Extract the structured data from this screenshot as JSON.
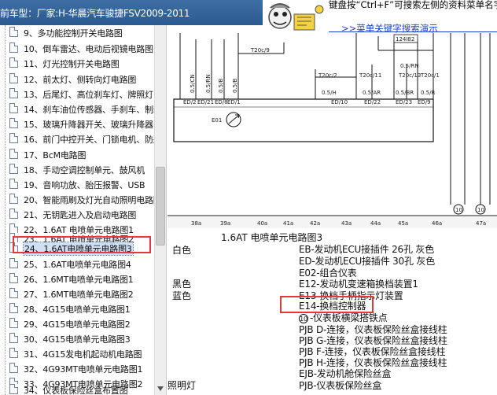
{
  "header": {
    "title": "前车型：厂家:H-华晨汽车骏捷FSV2009-2011",
    "hint_text": "键盘按“Ctrl+F”可搜索左侧的资料菜单名字!",
    "hint_link": ">>菜单关键字搜索演示"
  },
  "sidebar": {
    "items": [
      "9、多功能控制开关电路图",
      "10、倒车雷达、电动后视镜电路图",
      "11、灯光控制开关电路图",
      "12、前太灯、侧转向灯电路图",
      "13、后尾灯、高位刹车灯、牌照灯",
      "14、刹车油位传感器、手刹车、制动",
      "15、玻璃升降器开关、玻璃升降器",
      "16、前门中控开关、门锁电机、防盗",
      "17、BcM电路图",
      "18、手动空调控制单元、鼓风机",
      "19、音响功放、胎压报警、USB",
      "20、智能雨刷及灯光自动照明电路图",
      "21、无钥匙进入及启动电路图",
      "22、1.6AT 电喷单元电路图1",
      "23、1.6AT 电喷单元电路图2",
      "24、1.6AT电喷单元电路图3",
      "25、1.6AT电喷单元电路图4",
      "26、1.6MT电喷单元电路图1",
      "27、1.6MT电喷单元电路图2",
      "28、4G15电喷单元电路图1",
      "29、4G15电喷单元电路图2",
      "30、4G15电喷单元电路图3",
      "31、4G15发电机起动机电路图",
      "32、4G93MT电喷单元电路图1",
      "33、4G93MT电喷单元电路图2",
      "34、仪表板保险丝盒布置图"
    ],
    "selected_index": 15
  },
  "diagram": {
    "top_labels": [
      "124I82",
      "T20c/9",
      "0.5/RN",
      "T20c/2",
      "T20c/11",
      "T20c/13",
      "T20c/1",
      "0.5/H",
      "0.5/AR",
      "0.5/BR",
      "0.5/R"
    ],
    "vertical_labels": [
      "0.5/CN",
      "0.5/RN",
      "0.5/B",
      "0.5/B"
    ],
    "connector_labels": [
      "ED/2",
      "ED/21",
      "ED/8",
      "ED/1",
      "ED/10",
      "ED/22",
      "ED/23",
      "ED/9"
    ],
    "component_label": "E01",
    "ground_labels": [
      "10",
      "10"
    ],
    "pin_labels": [
      "38a",
      "39a",
      "40a",
      "41a",
      "42a",
      "43a",
      "44a",
      "45a",
      "46a",
      "47a"
    ]
  },
  "legend": {
    "title": "1.6AT 电喷单元电路图3",
    "left_labels": [
      "白色",
      "黑色",
      "蓝色",
      "照明灯"
    ],
    "entries": [
      "EB-发动机ECU接插件 26孔 灰色",
      "ED-发动机ECU接插件 30孔 灰色",
      "E02-组合仪表",
      "E12-发动机变速箱换档装置1",
      "E13-换档手柄指示灯装置",
      "E14-换档控制器",
      "-仪表板横梁搭铁点",
      "PJB D-连接，仪表板保险丝盒接线柱",
      "PJB G-连接，仪表板保险丝盒接线柱",
      "PJB F-连接，仪表板保险丝盒接线柱",
      "PJB H-连接，仪表板保险丝盒接线柱",
      "EJB-发动机舱保险丝盒",
      "PJB-仪表板保险丝盒"
    ],
    "ground_symbol": "10"
  },
  "colors": {
    "title_bar": "#2f5f96",
    "highlight_border": "#e23a3a",
    "link": "#1a3fd0"
  }
}
